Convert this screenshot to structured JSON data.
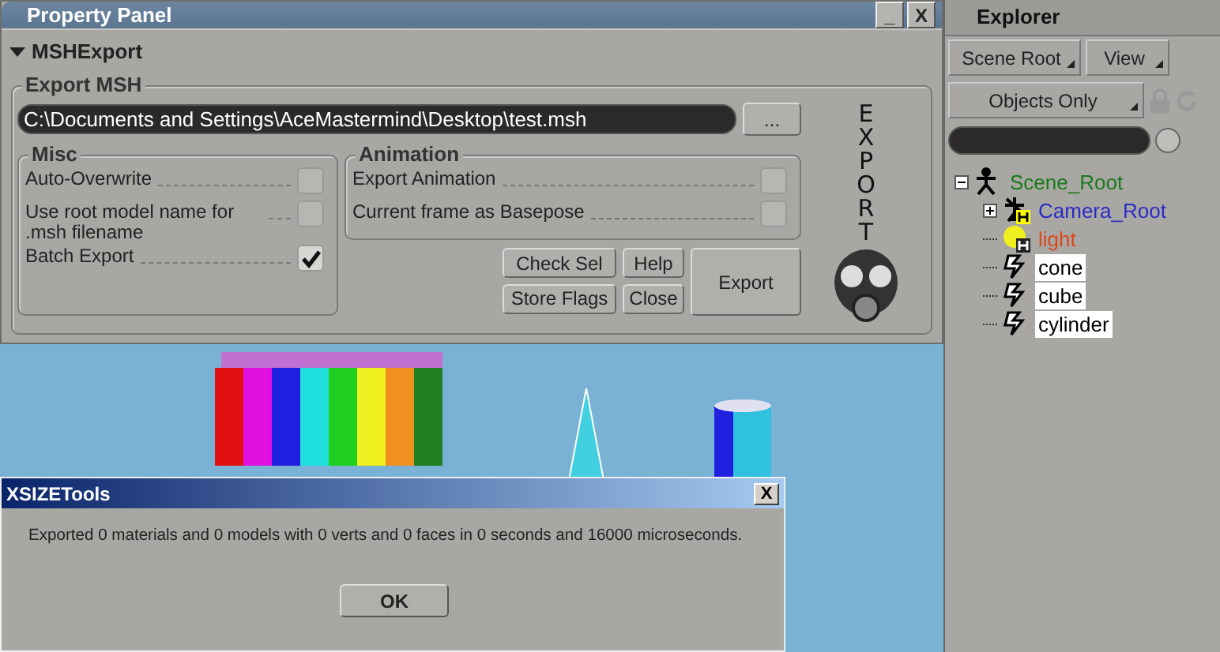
{
  "property_panel": {
    "title": "Property Panel",
    "minimize": "_",
    "close": "X",
    "section": {
      "title": "MSHExport",
      "expanded": true
    },
    "export_group": {
      "title": "Export MSH",
      "path": "C:\\Documents and Settings\\AceMastermind\\Desktop\\test.msh",
      "browse": "...",
      "misc": {
        "title": "Misc",
        "options": [
          {
            "label": "Auto-Overwrite",
            "checked": false
          },
          {
            "label": "Use root model name for .msh filename",
            "checked": false
          },
          {
            "label": "Batch Export",
            "checked": true
          }
        ]
      },
      "animation": {
        "title": "Animation",
        "options": [
          {
            "label": "Export Animation",
            "checked": false
          },
          {
            "label": "Current frame as Basepose",
            "checked": false
          }
        ]
      },
      "buttons": [
        "Check Sel",
        "Help",
        "Store Flags",
        "Close"
      ],
      "export_button": "Export",
      "logo": "EXPORT"
    }
  },
  "explorer": {
    "title": "Explorer",
    "scope": "Scene Root",
    "view": "View",
    "filter": "Objects Only",
    "tree": [
      {
        "label": "Scene_Root",
        "kind": "root",
        "color": "#1a7a1a",
        "selected": false,
        "expanded": true,
        "children": [
          {
            "label": "Camera_Root",
            "kind": "camera",
            "color": "#2a2ac8",
            "selected": false,
            "expanded": false
          },
          {
            "label": "light",
            "kind": "light",
            "color": "#d84a1a",
            "selected": false
          },
          {
            "label": "cone",
            "kind": "model",
            "color": "#000000",
            "selected": true
          },
          {
            "label": "cube",
            "kind": "model",
            "color": "#000000",
            "selected": true
          },
          {
            "label": "cylinder",
            "kind": "model",
            "color": "#000000",
            "selected": true
          }
        ]
      }
    ]
  },
  "dialog": {
    "title": "XSIZETools",
    "close": "X",
    "message": "Exported 0 materials and 0 models with 0 verts and 0 faces in 0 seconds and 16000 microseconds.",
    "ok": "OK"
  }
}
